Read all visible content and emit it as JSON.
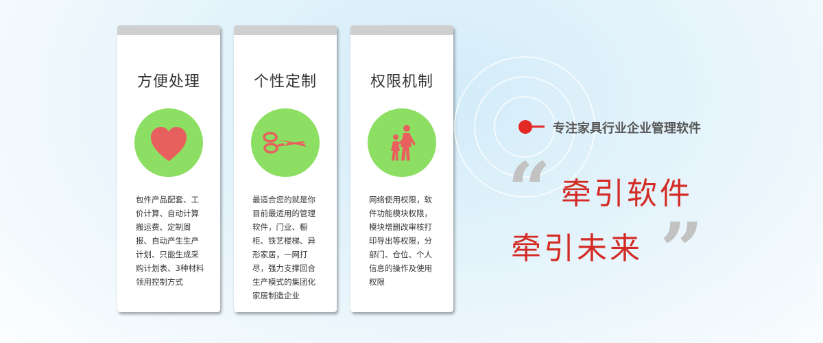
{
  "cards": [
    {
      "title": "方便处理",
      "icon": "heart-icon",
      "description": "包件产品配套、工价计算、自动计算搬运费、定制周报、自动产生生产计划、只能生成采购计划表、3种材料领用控制方式"
    },
    {
      "title": "个性定制",
      "icon": "scissors-icon",
      "description": "最适合您的就是你目前最适用的管理软件，门业、橱柜、铁艺楼梯、异形家居，一网打尽，强力支撑回合生产模式的集团化家居制造企业"
    },
    {
      "title": "权限机制",
      "icon": "people-walking-icon",
      "description": "网络使用权限，软件功能模块权限，模块增删改审核打印导出等权限，分部门、仓位、个人信息的操作及使用权限"
    }
  ],
  "tagline": "专注家具行业企业管理软件",
  "slogan": {
    "line1": "牵引软件",
    "line2": "牵引未来",
    "quote_open": "“",
    "quote_close": "”"
  },
  "colors": {
    "accent_red": "#e32a25",
    "icon_circle_green": "#8ddf63",
    "icon_fill_red": "#e8605e",
    "card_header_gray": "#cfcfcf"
  }
}
